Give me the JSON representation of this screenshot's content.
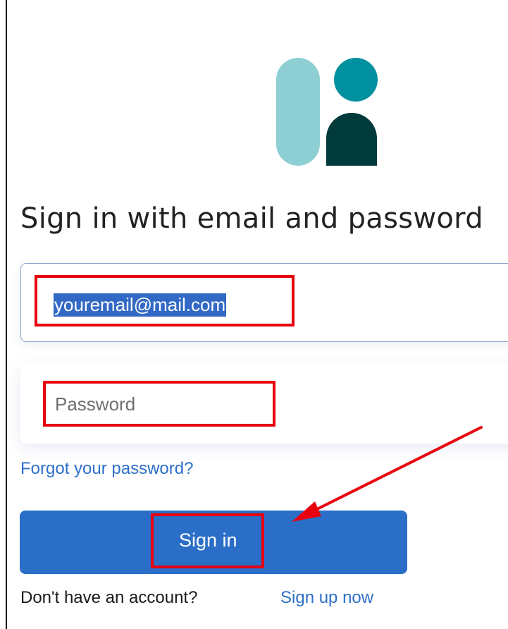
{
  "heading": "Sign in with email and password",
  "email": {
    "value": "youremail@mail.com"
  },
  "password": {
    "placeholder": "Password"
  },
  "links": {
    "forgot_password": "Forgot your password?",
    "no_account": "Don't have an account?",
    "sign_up": "Sign up now"
  },
  "buttons": {
    "sign_in": "Sign in"
  },
  "icons": {
    "logo": "brand-logo-icon",
    "arrow": "red-arrow-annotation-icon"
  },
  "colors": {
    "primary_button": "#2a6ec7",
    "link": "#2e6fc8",
    "highlight_box": "#e8000f",
    "selection": "#3169c4",
    "logo_light": "#8ecfd3",
    "logo_teal": "#00909e",
    "logo_dark": "#003a3b"
  }
}
